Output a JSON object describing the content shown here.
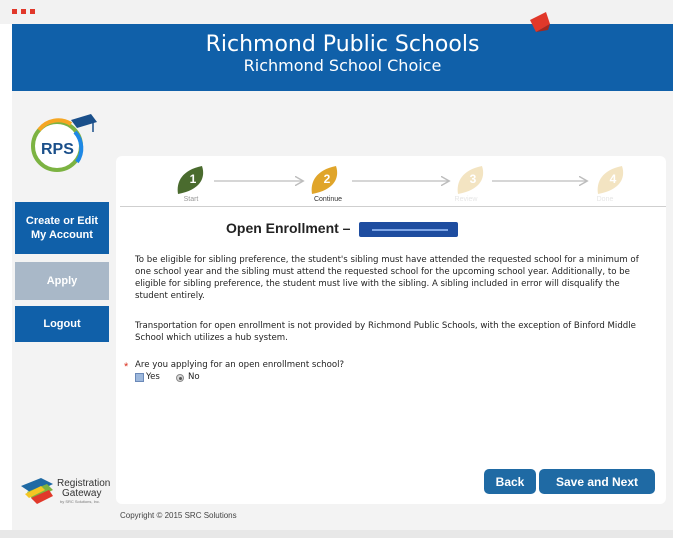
{
  "header": {
    "title": "Richmond Public Schools",
    "subtitle": "Richmond School Choice"
  },
  "sidebar": {
    "logo_text": "RPS",
    "buttons": [
      {
        "label": "Create or Edit My Account",
        "line1": "Create or Edit",
        "line2": "My Account"
      },
      {
        "label": "Apply"
      },
      {
        "label": "Logout"
      }
    ],
    "gateway": {
      "line1": "Registration",
      "line2": "Gateway",
      "line3": "by SRC Solutions, Inc."
    }
  },
  "progress": {
    "steps": [
      {
        "number": "1",
        "label": "Start",
        "state": "completed"
      },
      {
        "number": "2",
        "label": "Continue",
        "state": "current"
      },
      {
        "number": "3",
        "label": "Review",
        "state": "pending"
      },
      {
        "number": "4",
        "label": "Done",
        "state": "pending"
      }
    ]
  },
  "main": {
    "section_title": "Open Enrollment –",
    "paragraph1": "To be eligible for sibling preference, the student's sibling must have attended the requested school for a minimum of one school year and the sibling must attend the requested school for the upcoming school year. Additionally, to be eligible for sibling preference, the student must live with the sibling. A sibling included in error will disqualify the student entirely.",
    "paragraph2": "Transportation for open enrollment is not provided by Richmond Public Schools, with the exception of Binford Middle School which utilizes a hub system.",
    "question": "Are you applying for an open enrollment school?",
    "required_marker": "*",
    "options": {
      "yes": "Yes",
      "no": "No"
    }
  },
  "actions": {
    "back": "Back",
    "save_next": "Save and Next"
  },
  "footer": {
    "copyright": "Copyright © 2015 SRC Solutions"
  },
  "colors": {
    "header_blue": "#1060a9",
    "button_blue": "#1f6aa4",
    "disabled": "#a9b8c8",
    "step_done": "#4a6b2e",
    "step_current": "#e0a52a"
  }
}
